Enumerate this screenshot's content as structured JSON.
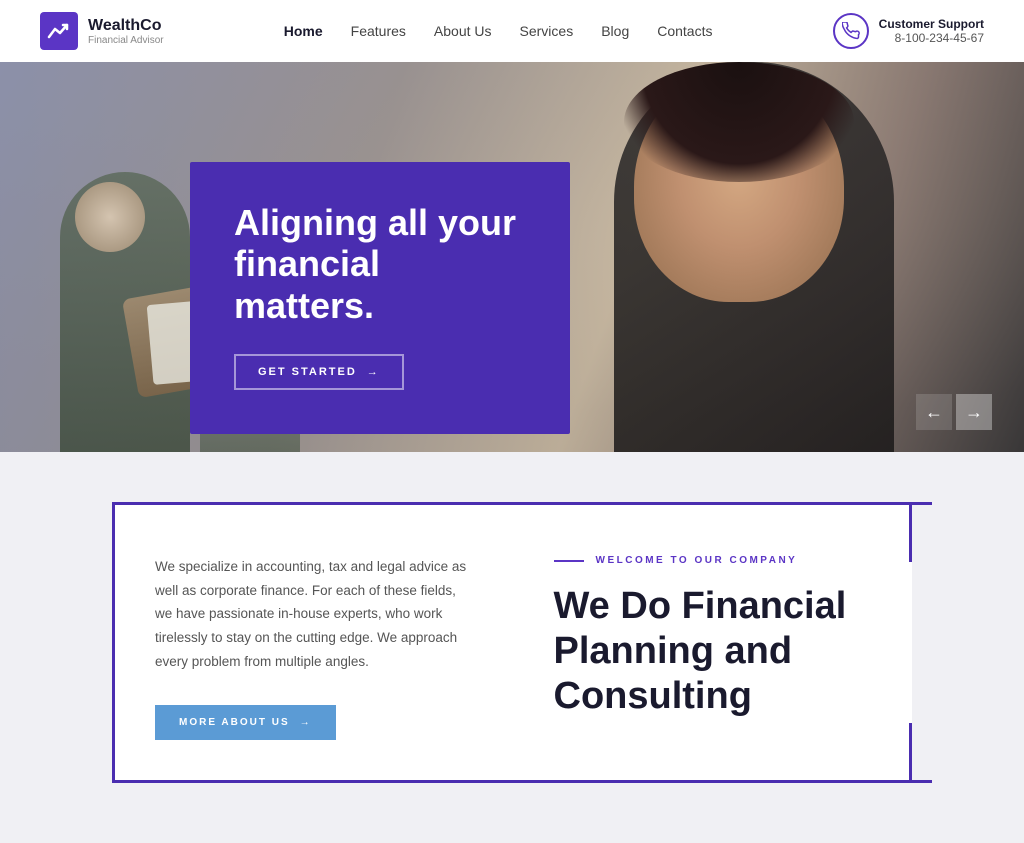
{
  "brand": {
    "name": "WealthCo",
    "tagline": "Financial Advisor",
    "logo_icon": "chart-icon"
  },
  "nav": {
    "items": [
      {
        "label": "Home",
        "active": true
      },
      {
        "label": "Features",
        "active": false
      },
      {
        "label": "About Us",
        "active": false
      },
      {
        "label": "Services",
        "active": false
      },
      {
        "label": "Blog",
        "active": false
      },
      {
        "label": "Contacts",
        "active": false
      }
    ]
  },
  "support": {
    "label": "Customer Support",
    "phone": "8-100-234-45-67"
  },
  "hero": {
    "title": "Aligning all your financial matters.",
    "cta_label": "GET STARTED",
    "arrow_left": "←",
    "arrow_right": "→"
  },
  "section": {
    "left_text": "We specialize in accounting, tax and legal advice as well as corporate finance. For each of these fields, we have passionate in-house experts, who work tirelessly to stay on the cutting edge. We approach every problem from multiple angles.",
    "more_label": "MORE ABOUT US",
    "welcome_label": "WELCOME TO OUR COMPANY",
    "heading_line1": "We Do Financial",
    "heading_line2": "Planning and",
    "heading_line3": "Consulting"
  }
}
